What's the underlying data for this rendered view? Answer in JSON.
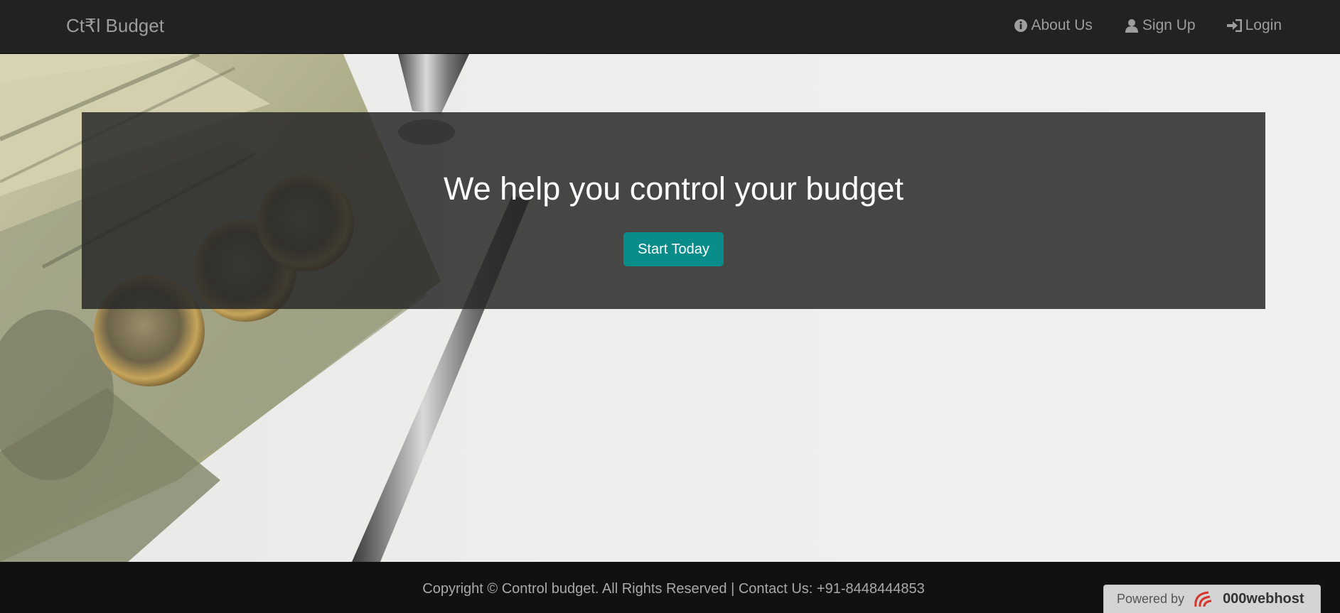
{
  "brand": "Ct₹l Budget",
  "nav": {
    "about": "About Us",
    "signup": "Sign Up",
    "login": "Login"
  },
  "hero": {
    "title": "We help you control your budget",
    "cta": "Start Today"
  },
  "footer": {
    "text": "Copyright © Control budget. All Rights Reserved | Contact Us: +91-8448444853"
  },
  "powered": {
    "label": "Powered by",
    "brand": "000webhost"
  },
  "colors": {
    "navbar": "#222222",
    "footer": "#111111",
    "accent": "#0a8c8a"
  }
}
